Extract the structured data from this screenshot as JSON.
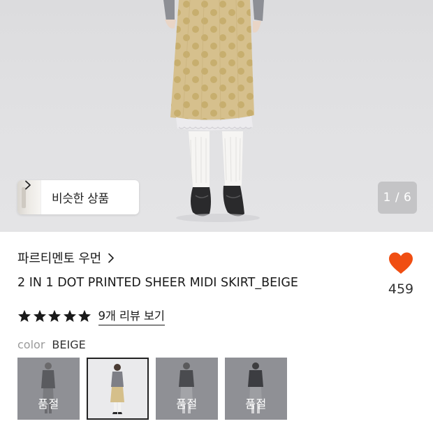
{
  "hero": {
    "similar_button_label": "비슷한 상품",
    "page_indicator": "1 / 6",
    "image_description_icon": "product-photo"
  },
  "product": {
    "brand": "파르티멘토 우먼",
    "title": "2 IN 1 DOT PRINTED SHEER MIDI SKIRT_BEIGE",
    "like_count": "459",
    "rating_stars": 5,
    "review_link": "9개 리뷰 보기"
  },
  "color_option": {
    "label": "color",
    "value": "BEIGE"
  },
  "swatches": [
    {
      "status": "품절",
      "selected": false
    },
    {
      "status": "",
      "selected": true
    },
    {
      "status": "품절",
      "selected": false
    },
    {
      "status": "품절",
      "selected": false
    }
  ],
  "colors": {
    "heart": "#f04e12",
    "star": "#1a1a1a",
    "skirt": "#d5bf8a",
    "dot": "#c6ad6c",
    "sold_out_overlay": "#8f9095"
  }
}
